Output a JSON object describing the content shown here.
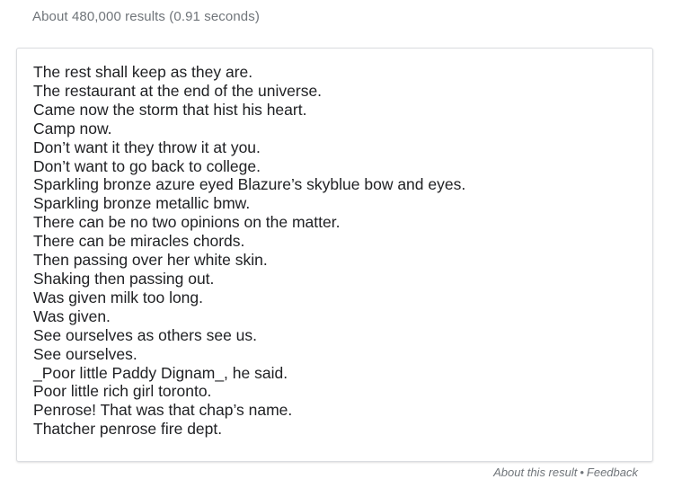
{
  "results_stats": "About 480,000 results (0.91 seconds)",
  "snippet": {
    "lines": [
      "The rest shall keep as they are.",
      "The restaurant at the end of the universe.",
      "Came now the storm that hist his heart.",
      "Camp now.",
      "Don’t want it they throw it at you.",
      "Don’t want to go back to college.",
      "Sparkling bronze azure eyed Blazure’s skyblue bow and eyes.",
      "Sparkling bronze metallic bmw.",
      "There can be no two opinions on the matter.",
      "There can be miracles chords.",
      "Then passing over her white skin.",
      "Shaking then passing out.",
      "Was given milk too long.",
      "Was given.",
      "See ourselves as others see us.",
      "See ourselves.",
      "_Poor little Paddy Dignam_, he said.",
      "Poor little rich girl toronto.",
      "Penrose! That was that chap’s name.",
      "Thatcher penrose fire dept."
    ]
  },
  "footer": {
    "about_label": "About this result",
    "separator": "•",
    "feedback_label": "Feedback"
  },
  "colors": {
    "stats_text": "#70757a",
    "body_text": "#202124",
    "card_border": "#dadce0"
  }
}
